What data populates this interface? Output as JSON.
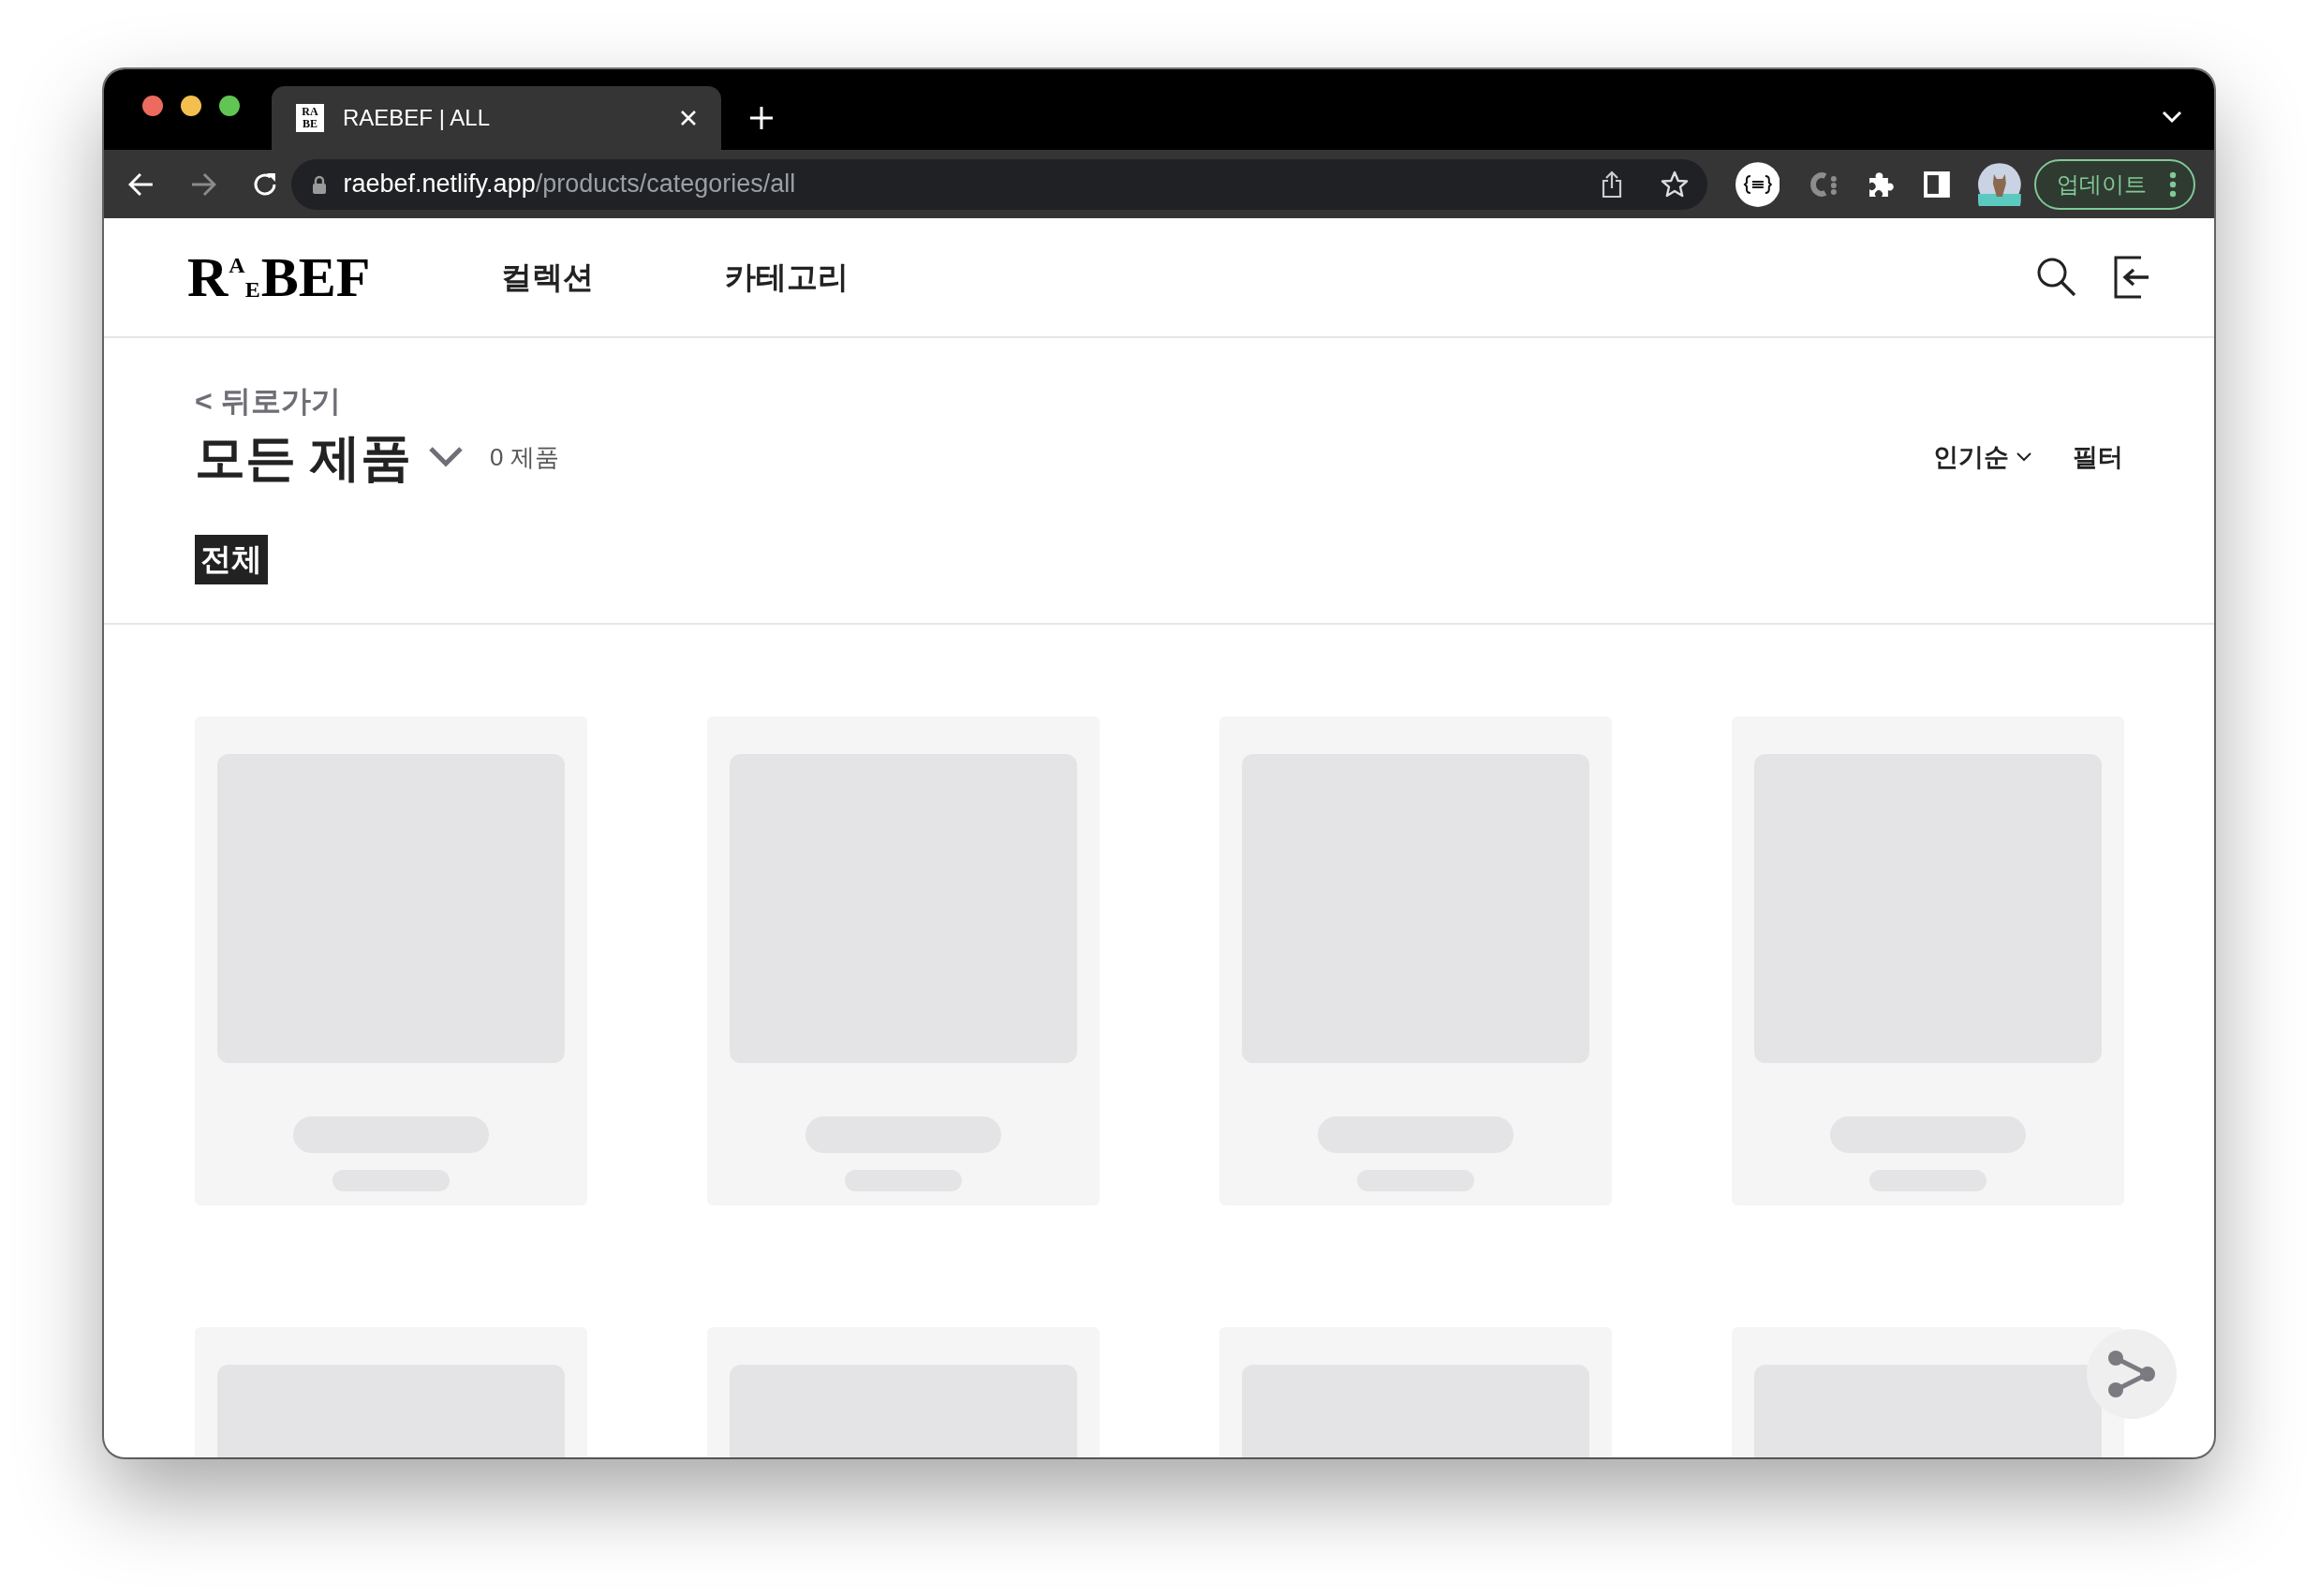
{
  "browser": {
    "tab": {
      "favicon_lines": [
        "RA",
        "BE"
      ],
      "title": "RAEBEF | ALL",
      "selected": true
    },
    "url": {
      "host": "raebef.netlify.app",
      "path": "/products/categories/all"
    },
    "update_button": "업데이트"
  },
  "header": {
    "logo_letters": [
      "R",
      "A",
      "E",
      "B",
      "E",
      "F"
    ],
    "nav": [
      {
        "label": "컬렉션"
      },
      {
        "label": "카테고리"
      }
    ]
  },
  "page": {
    "back_link": "< 뒤로가기",
    "title": "모든 제품",
    "count": "0 제품",
    "sort": "인기순",
    "filter": "필터",
    "chips": [
      {
        "label": "전체",
        "selected": true
      }
    ]
  },
  "products": [
    {
      "kind": "skeleton"
    },
    {
      "kind": "skeleton"
    },
    {
      "kind": "skeleton"
    },
    {
      "kind": "skeleton"
    },
    {
      "kind": "skeleton_top"
    },
    {
      "kind": "skeleton_top"
    },
    {
      "kind": "skeleton_top"
    },
    {
      "kind": "skeleton_top"
    }
  ]
}
